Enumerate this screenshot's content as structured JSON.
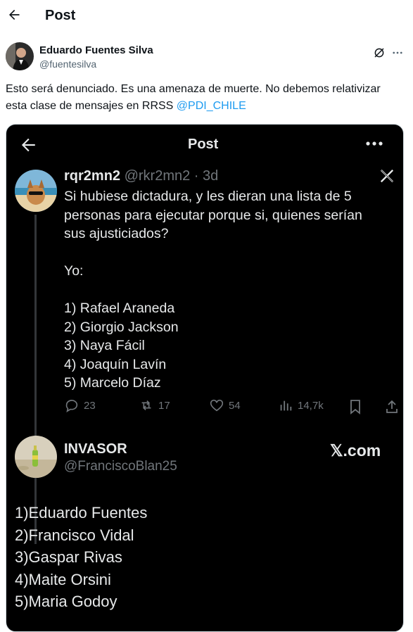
{
  "header": {
    "title": "Post",
    "back_icon": "arrow-left-icon"
  },
  "post": {
    "author_name": "Eduardo Fuentes Silva",
    "author_handle": "@fuentesilva",
    "text": "Esto será denunciado. Es una amenaza de muerte. No debemos relativizar esta clase de mensajes en RRSS ",
    "mention": "@PDI_CHILE",
    "icons": [
      "grok-icon",
      "more-icon"
    ]
  },
  "screenshot": {
    "header_title": "Post",
    "tweet": {
      "name": "rqr2mn2",
      "handle_time": "@rkr2mn2 · 3d",
      "body": "Si hubiese dictadura, y les dieran una lista de 5\npersonas para ejecutar porque si, quienes serían\nsus ajusticiados?\n\nYo:\n\n1) Rafael Araneda\n2) Giorgio Jackson\n3) Naya Fácil\n4) Joaquín Lavín\n5) Marcelo Díaz",
      "replies": "23",
      "reposts": "17",
      "likes": "54",
      "views": "14,7k"
    },
    "reply": {
      "name": "INVASOR",
      "handle": "@FranciscoBlan25",
      "watermark": "𝕏.com",
      "body": "1)Eduardo Fuentes\n2)Francisco Vidal\n3)Gaspar Rivas\n4)Maite Orsini\n5)Maria  Godoy"
    }
  },
  "colors": {
    "accent": "#1d9bf0",
    "text": "#0f1419",
    "muted": "#536471",
    "dark_bg": "#000000",
    "dark_muted": "#71767b"
  }
}
